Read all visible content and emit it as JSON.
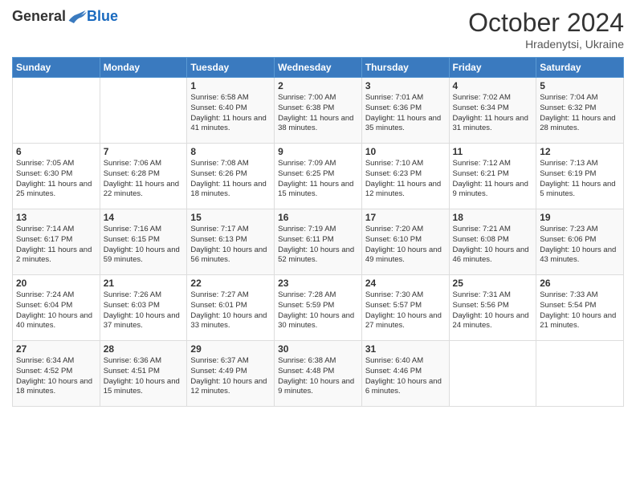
{
  "header": {
    "logo_general": "General",
    "logo_blue": "Blue",
    "month_title": "October 2024",
    "subtitle": "Hradenytsi, Ukraine"
  },
  "days_of_week": [
    "Sunday",
    "Monday",
    "Tuesday",
    "Wednesday",
    "Thursday",
    "Friday",
    "Saturday"
  ],
  "weeks": [
    [
      {
        "day": "",
        "content": ""
      },
      {
        "day": "",
        "content": ""
      },
      {
        "day": "1",
        "content": "Sunrise: 6:58 AM\nSunset: 6:40 PM\nDaylight: 11 hours and 41 minutes."
      },
      {
        "day": "2",
        "content": "Sunrise: 7:00 AM\nSunset: 6:38 PM\nDaylight: 11 hours and 38 minutes."
      },
      {
        "day": "3",
        "content": "Sunrise: 7:01 AM\nSunset: 6:36 PM\nDaylight: 11 hours and 35 minutes."
      },
      {
        "day": "4",
        "content": "Sunrise: 7:02 AM\nSunset: 6:34 PM\nDaylight: 11 hours and 31 minutes."
      },
      {
        "day": "5",
        "content": "Sunrise: 7:04 AM\nSunset: 6:32 PM\nDaylight: 11 hours and 28 minutes."
      }
    ],
    [
      {
        "day": "6",
        "content": "Sunrise: 7:05 AM\nSunset: 6:30 PM\nDaylight: 11 hours and 25 minutes."
      },
      {
        "day": "7",
        "content": "Sunrise: 7:06 AM\nSunset: 6:28 PM\nDaylight: 11 hours and 22 minutes."
      },
      {
        "day": "8",
        "content": "Sunrise: 7:08 AM\nSunset: 6:26 PM\nDaylight: 11 hours and 18 minutes."
      },
      {
        "day": "9",
        "content": "Sunrise: 7:09 AM\nSunset: 6:25 PM\nDaylight: 11 hours and 15 minutes."
      },
      {
        "day": "10",
        "content": "Sunrise: 7:10 AM\nSunset: 6:23 PM\nDaylight: 11 hours and 12 minutes."
      },
      {
        "day": "11",
        "content": "Sunrise: 7:12 AM\nSunset: 6:21 PM\nDaylight: 11 hours and 9 minutes."
      },
      {
        "day": "12",
        "content": "Sunrise: 7:13 AM\nSunset: 6:19 PM\nDaylight: 11 hours and 5 minutes."
      }
    ],
    [
      {
        "day": "13",
        "content": "Sunrise: 7:14 AM\nSunset: 6:17 PM\nDaylight: 11 hours and 2 minutes."
      },
      {
        "day": "14",
        "content": "Sunrise: 7:16 AM\nSunset: 6:15 PM\nDaylight: 10 hours and 59 minutes."
      },
      {
        "day": "15",
        "content": "Sunrise: 7:17 AM\nSunset: 6:13 PM\nDaylight: 10 hours and 56 minutes."
      },
      {
        "day": "16",
        "content": "Sunrise: 7:19 AM\nSunset: 6:11 PM\nDaylight: 10 hours and 52 minutes."
      },
      {
        "day": "17",
        "content": "Sunrise: 7:20 AM\nSunset: 6:10 PM\nDaylight: 10 hours and 49 minutes."
      },
      {
        "day": "18",
        "content": "Sunrise: 7:21 AM\nSunset: 6:08 PM\nDaylight: 10 hours and 46 minutes."
      },
      {
        "day": "19",
        "content": "Sunrise: 7:23 AM\nSunset: 6:06 PM\nDaylight: 10 hours and 43 minutes."
      }
    ],
    [
      {
        "day": "20",
        "content": "Sunrise: 7:24 AM\nSunset: 6:04 PM\nDaylight: 10 hours and 40 minutes."
      },
      {
        "day": "21",
        "content": "Sunrise: 7:26 AM\nSunset: 6:03 PM\nDaylight: 10 hours and 37 minutes."
      },
      {
        "day": "22",
        "content": "Sunrise: 7:27 AM\nSunset: 6:01 PM\nDaylight: 10 hours and 33 minutes."
      },
      {
        "day": "23",
        "content": "Sunrise: 7:28 AM\nSunset: 5:59 PM\nDaylight: 10 hours and 30 minutes."
      },
      {
        "day": "24",
        "content": "Sunrise: 7:30 AM\nSunset: 5:57 PM\nDaylight: 10 hours and 27 minutes."
      },
      {
        "day": "25",
        "content": "Sunrise: 7:31 AM\nSunset: 5:56 PM\nDaylight: 10 hours and 24 minutes."
      },
      {
        "day": "26",
        "content": "Sunrise: 7:33 AM\nSunset: 5:54 PM\nDaylight: 10 hours and 21 minutes."
      }
    ],
    [
      {
        "day": "27",
        "content": "Sunrise: 6:34 AM\nSunset: 4:52 PM\nDaylight: 10 hours and 18 minutes."
      },
      {
        "day": "28",
        "content": "Sunrise: 6:36 AM\nSunset: 4:51 PM\nDaylight: 10 hours and 15 minutes."
      },
      {
        "day": "29",
        "content": "Sunrise: 6:37 AM\nSunset: 4:49 PM\nDaylight: 10 hours and 12 minutes."
      },
      {
        "day": "30",
        "content": "Sunrise: 6:38 AM\nSunset: 4:48 PM\nDaylight: 10 hours and 9 minutes."
      },
      {
        "day": "31",
        "content": "Sunrise: 6:40 AM\nSunset: 4:46 PM\nDaylight: 10 hours and 6 minutes."
      },
      {
        "day": "",
        "content": ""
      },
      {
        "day": "",
        "content": ""
      }
    ]
  ]
}
